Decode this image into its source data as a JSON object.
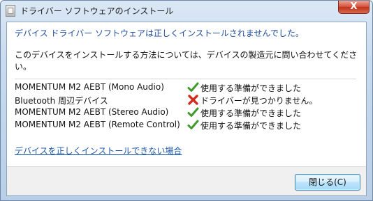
{
  "window": {
    "title": "ドライバー ソフトウェアのインストール",
    "close_glyph": "X"
  },
  "dialog": {
    "heading": "デバイス ドライバー ソフトウェアは正しくインストールされませんでした。",
    "description": "このデバイスをインストールする方法については、デバイスの製造元に問い合わせてください。"
  },
  "devices": [
    {
      "name": "MOMENTUM M2 AEBT (Mono Audio)",
      "status": "使用する準備ができました",
      "icon": "checkmark-icon"
    },
    {
      "name": "Bluetooth 周辺デバイス",
      "status": "ドライバーが見つかりません。",
      "icon": "error-x-icon"
    },
    {
      "name": "MOMENTUM M2 AEBT (Stereo Audio)",
      "status": "使用する準備ができました",
      "icon": "checkmark-icon"
    },
    {
      "name": "MOMENTUM M2 AEBT (Remote Control)",
      "status": "使用する準備ができました",
      "icon": "checkmark-icon"
    }
  ],
  "help_link": "デバイスを正しくインストールできない場合",
  "buttons": {
    "close_label": "閉じる(C)"
  },
  "colors": {
    "heading": "#1f4ea0",
    "link": "#1d5aa8",
    "check_green": "#3f9a2a",
    "error_red": "#d32b1e"
  }
}
